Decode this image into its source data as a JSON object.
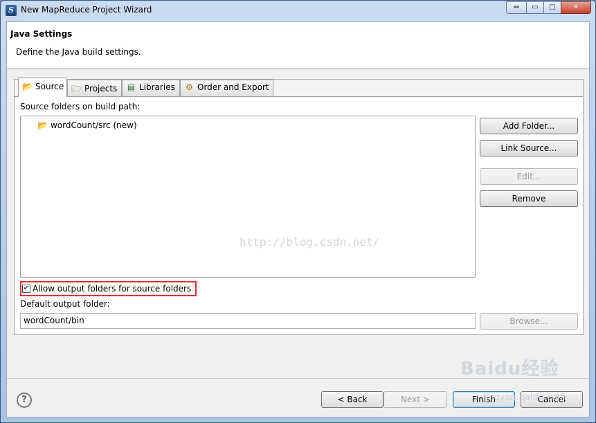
{
  "window": {
    "title": "New MapReduce Project Wizard",
    "controls": {
      "restore": "⇔",
      "minimize": "▭",
      "maximize": "□",
      "close": "✕"
    }
  },
  "header": {
    "title": "Java Settings",
    "description": "Define the Java build settings."
  },
  "tabs": [
    {
      "label": "Source",
      "icon": "source-folder-icon",
      "selected": true
    },
    {
      "label": "Projects",
      "icon": "projects-icon",
      "selected": false
    },
    {
      "label": "Libraries",
      "icon": "libraries-icon",
      "selected": false
    },
    {
      "label": "Order and Export",
      "icon": "order-export-icon",
      "selected": false
    }
  ],
  "source": {
    "section_label": "Source folders on build path:",
    "folders": [
      {
        "label": "wordCount/src (new)",
        "icon": "source-folder-icon"
      }
    ],
    "buttons": {
      "add_folder": "Add Folder...",
      "link_source": "Link Source...",
      "edit": "Edit...",
      "remove": "Remove"
    },
    "allow_output": {
      "label": "Allow output folders for source folders",
      "checked": true
    },
    "default_output_label": "Default output folder:",
    "default_output_value": "wordCount/bin",
    "browse": "Browse..."
  },
  "footer": {
    "help": "?",
    "back": "< Back",
    "next": "Next >",
    "finish": "Finish",
    "cancel": "Cancel"
  },
  "watermarks": {
    "csdn": "http://blog.csdn.net/",
    "baidu": "Baidu经验",
    "baidu_url": "jingyan.baidu.com"
  },
  "colors": {
    "highlight_border": "#d9362b"
  }
}
